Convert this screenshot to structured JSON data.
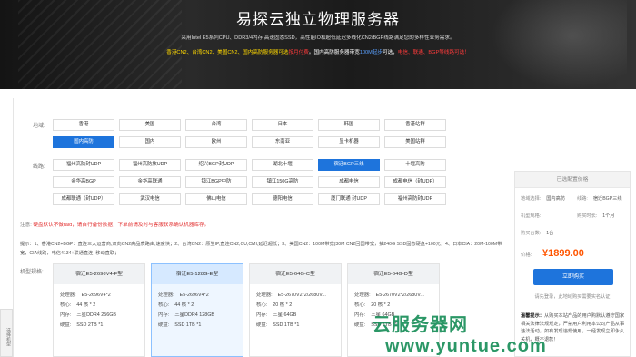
{
  "hero": {
    "title": "易探云独立物理服务器",
    "subtitle": "采用Intel E5系列CPU、DDR3/4内存 高速固态SSD，高性能IO和超低延迟多线化CN2/BGP线路满足您的多样性业务需求。",
    "line_a": "香港CN2、台湾CN2、美国CN2、国内高防服务器可选",
    "line_b": "按月付费",
    "line_c": "。国内高防服务器带宽",
    "line_d": "100M起步",
    "line_e": "可选，",
    "line_f": "电信、联通、BGP等线路可选！"
  },
  "regions": {
    "label": "地域:",
    "items": [
      "香港",
      "美国",
      "台湾",
      "日本",
      "韩国",
      "香港站群",
      "国内高防",
      "国内",
      "欧州",
      "东南亚",
      "显卡机器",
      "美国站群"
    ],
    "active": "国内高防"
  },
  "lines": {
    "label": "线路:",
    "items": [
      "福州高防封UDP",
      "福州高防放UDP",
      "绍兴BGP封UDP",
      "湖北十堰",
      "宿迁BGP三线",
      "十堰高防",
      "金华高BGP",
      "金华高联通",
      "镇江BGP中防",
      "镇江150G高防",
      "成都电信",
      "成都电信（封UDP）",
      "成都联通（封UDP）",
      "武汉电信",
      "佛山电信",
      "德阳电信",
      "厦门联通 封UDP",
      "福州高防封UDP"
    ],
    "active": "宿迁BGP三线"
  },
  "notice": {
    "label": "注意:",
    "text": "硬盘默认不做raid，请自行备份数据，下单前请及时与客服联系确认机器库存。"
  },
  "tips": {
    "label": "提示：",
    "text": "1、香港CN2+BGP：直连三大运营商,双向CN2高品质路由,速度快；2、台湾CN2：原生IP,直连CN2,CU,CMI,延迟超低；3、美国CN2：100M带宽(30M CN2回国带宽，抽240G SSD固态硬盘+100元；4、日本CIA：20M-100M带宽，CIA线路，电信4134+联通直连+移动直联；"
  },
  "models": {
    "label": "机型规格:",
    "side_tab": "选择机型",
    "cards": [
      {
        "name": "宿迁E5-2696V4-F型",
        "cpu": "E5-2696V4*2",
        "core": "44 核 * 2",
        "mem": "三星DDR4 256GB",
        "disk": "SSD 2TB *1",
        "selected": false
      },
      {
        "name": "宿迁E5-128G-E型",
        "cpu": "E5-2696V4*2",
        "core": "44 核 * 2",
        "mem": "三星DDR4 128GB",
        "disk": "SSD 1TB *1",
        "selected": true
      },
      {
        "name": "宿迁E5-64G-C型",
        "cpu": "E5-2670V2*2/2680V...",
        "core": "20 核 * 2",
        "mem": "三星 64GB",
        "disk": "SSD 1TB *1",
        "selected": false
      },
      {
        "name": "宿迁E5-64G-D型",
        "cpu": "E5-2670V2*2/2680V...",
        "core": "20 核 * 2",
        "mem": "三星 64GB",
        "disk": "SSD 1TB *1",
        "selected": false
      }
    ],
    "field_labels": {
      "cpu": "处理器:",
      "core": "核心:",
      "mem": "内存:",
      "disk": "硬盘:"
    }
  },
  "summary": {
    "title": "已选配置价格",
    "region_label": "地域选择:",
    "region_value": "国内高防",
    "line_label": "线路:",
    "line_value": "宿迁BGP三线",
    "model_label": "机型规格:",
    "model_value": "",
    "cycle_label": "购买时长:",
    "cycle_value": "1个月",
    "qty_label": "购买台数:",
    "qty_value": "1台",
    "price_label": "价格:",
    "price": "¥1899.00",
    "buy_label": "立即购买",
    "login_tip": "请先登录，此地域购买需要实名认证",
    "warm_title": "温馨提示：",
    "warm_text": "从购买本站产品的用户购默认遵守国家相关法律法规规定，严禁用户利用本公司产品从事违法活动，如有发现违规使用，一经发现立即永久关机，概不退款！"
  },
  "watermark": {
    "brand": "云服务器网",
    "url": "www.yuntue.com"
  }
}
